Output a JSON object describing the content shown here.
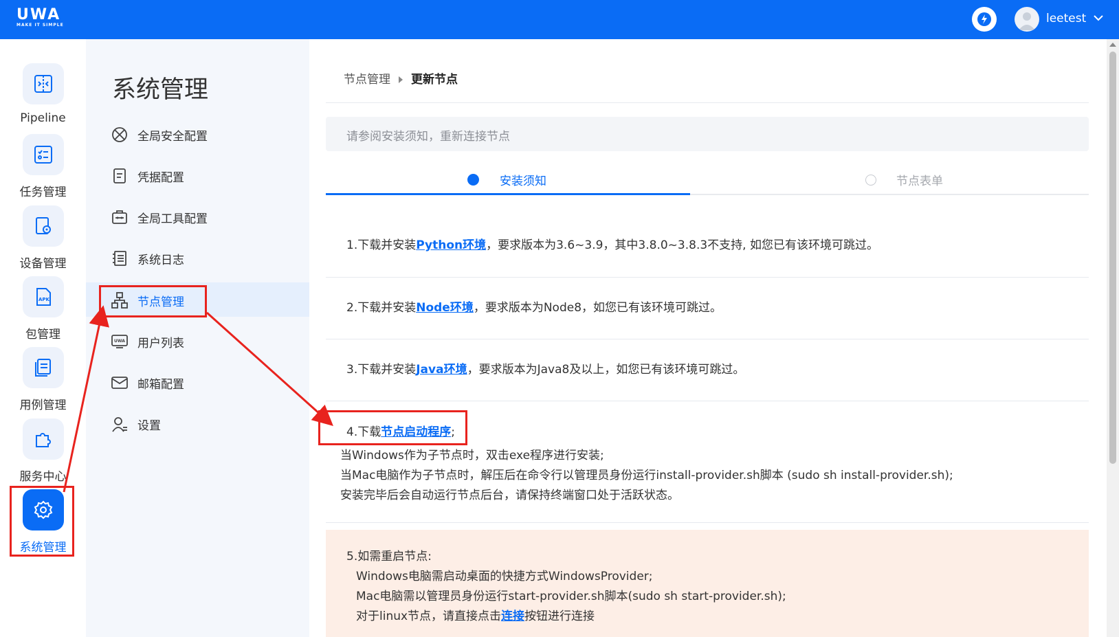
{
  "topbar": {
    "logo": "UWA",
    "logo_sub": "MAKE IT SIMPLE",
    "username": "leetest"
  },
  "rail": [
    {
      "label": "Pipeline",
      "icon": "pipeline-icon"
    },
    {
      "label": "任务管理",
      "icon": "task-icon"
    },
    {
      "label": "设备管理",
      "icon": "device-icon"
    },
    {
      "label": "包管理",
      "icon": "apk-icon"
    },
    {
      "label": "用例管理",
      "icon": "case-icon"
    },
    {
      "label": "服务中心",
      "icon": "puzzle-icon"
    },
    {
      "label": "系统管理",
      "icon": "gear-icon",
      "active": true
    }
  ],
  "sidebar": {
    "title": "系统管理",
    "items": [
      {
        "label": "全局安全配置",
        "icon": "security-icon"
      },
      {
        "label": "凭据配置",
        "icon": "credential-icon"
      },
      {
        "label": "全局工具配置",
        "icon": "toolbox-icon"
      },
      {
        "label": "系统日志",
        "icon": "log-icon"
      },
      {
        "label": "节点管理",
        "icon": "node-icon",
        "active": true
      },
      {
        "label": "用户列表",
        "icon": "user-list-icon"
      },
      {
        "label": "邮箱配置",
        "icon": "mail-icon"
      },
      {
        "label": "设置",
        "icon": "settings-user-icon"
      }
    ]
  },
  "main": {
    "breadcrumb": [
      "节点管理",
      "更新节点"
    ],
    "notice": "请参阅安装须知，重新连接节点",
    "steps": [
      "安装须知",
      "节点表单"
    ],
    "items": {
      "s1": {
        "pre": "1.下载并安装",
        "link": "Python环境",
        "post": "，要求版本为3.6~3.9，其中3.8.0~3.8.3不支持, 如您已有该环境可跳过。"
      },
      "s2": {
        "pre": "2.下载并安装",
        "link": "Node环境",
        "post": "，要求版本为Node8，如您已有该环境可跳过。"
      },
      "s3": {
        "pre": "3.下载并安装",
        "link": "Java环境",
        "post": "，要求版本为Java8及以上，如您已有该环境可跳过。"
      },
      "s4": {
        "pre": "4.下载",
        "link": "节点启动程序",
        "post": ";",
        "lines": [
          "当Windows作为子节点时，双击exe程序进行安装;",
          "当Mac电脑作为子节点时，解压后在命令行以管理员身份运行install-provider.sh脚本 (sudo sh install-provider.sh);",
          "安装完毕后会自动运行节点后台，请保持终端窗口处于活跃状态。"
        ]
      },
      "s5": {
        "title": "5.如需重启节点:",
        "lines": [
          "Windows电脑需启动桌面的快捷方式WindowsProvider;",
          "Mac电脑需以管理员身份运行start-provider.sh脚本(sudo sh start-provider.sh);"
        ],
        "last_pre": "对于linux节点，请直接点击",
        "last_link": "连接",
        "last_post": "按钮进行连接"
      }
    }
  },
  "colors": {
    "brand": "#0a6cf5",
    "annotation": "#e8231e",
    "notice_bg": "#fdeee6"
  }
}
